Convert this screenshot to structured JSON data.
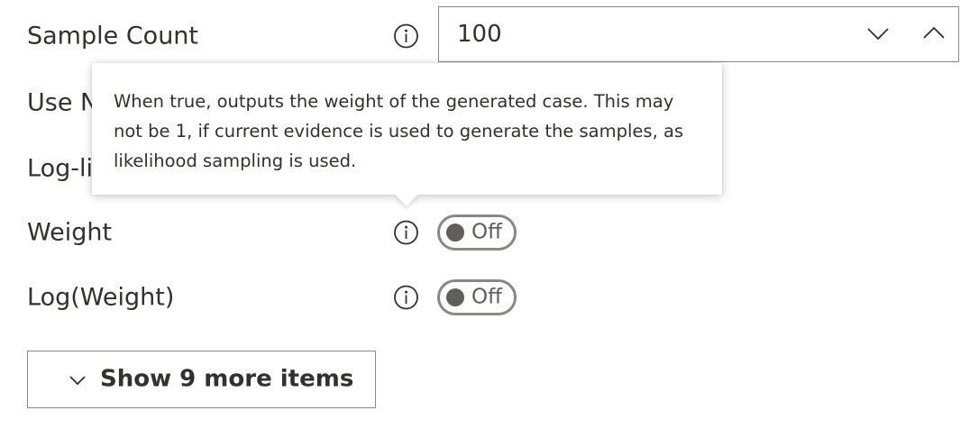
{
  "rows": [
    {
      "label": "Sample Count",
      "type": "number",
      "value": "100"
    },
    {
      "label": "Use N",
      "type": "text"
    },
    {
      "label": "Log-li",
      "type": "text"
    },
    {
      "label": "Weight",
      "type": "toggle",
      "state": "Off"
    },
    {
      "label": "Log(Weight)",
      "type": "toggle",
      "state": "Off"
    }
  ],
  "tooltip": {
    "text": "When true, outputs the weight of the generated case. This may not be 1, if current evidence is used to generate the samples, as likelihood sampling is used."
  },
  "show_more": {
    "label": "Show 9 more items"
  },
  "icons": {
    "info": "info-circle-icon",
    "spin_down": "chevron-down-icon",
    "spin_up": "chevron-up-icon",
    "show_more": "chevron-down-icon"
  },
  "colors": {
    "text": "#323130",
    "border": "#8a8886",
    "knob": "#605e5c"
  }
}
